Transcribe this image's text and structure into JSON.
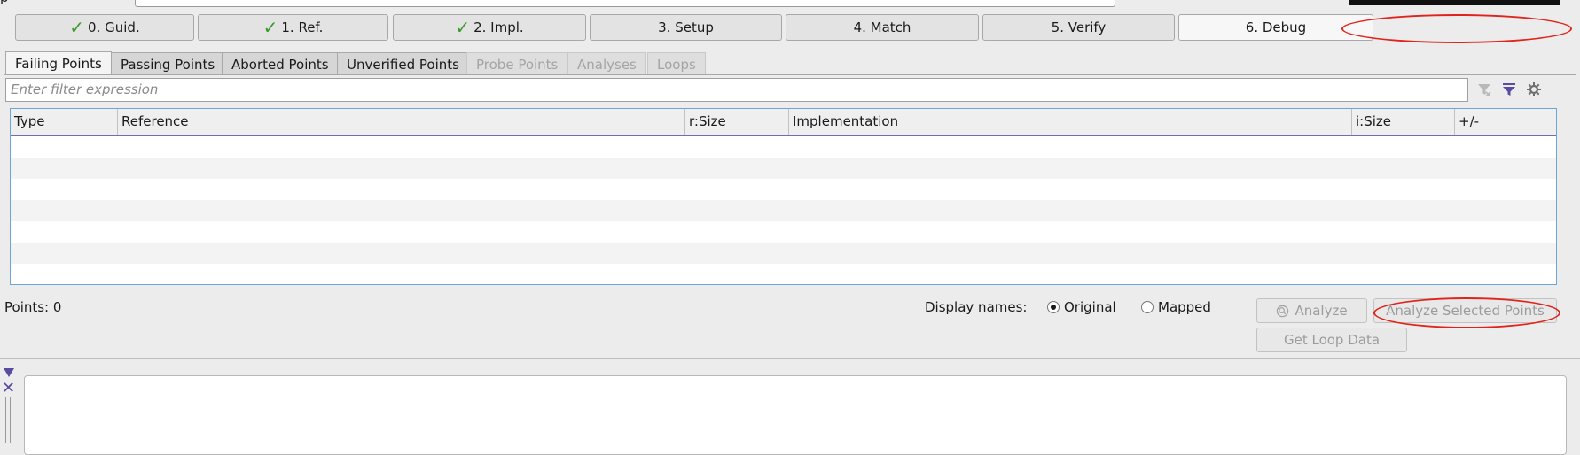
{
  "top_label": "p",
  "steps": [
    {
      "label": "0. Guid.",
      "done": true
    },
    {
      "label": "1. Ref.",
      "done": true
    },
    {
      "label": "2. Impl.",
      "done": true
    },
    {
      "label": "3. Setup",
      "done": false
    },
    {
      "label": "4. Match",
      "done": false
    },
    {
      "label": "5. Verify",
      "done": false
    },
    {
      "label": "6. Debug",
      "done": false,
      "active": true
    }
  ],
  "tabs": [
    {
      "label": "Failing Points",
      "state": "active"
    },
    {
      "label": "Passing Points",
      "state": "normal"
    },
    {
      "label": "Aborted Points",
      "state": "normal"
    },
    {
      "label": "Unverified Points",
      "state": "normal"
    },
    {
      "label": "Probe Points",
      "state": "disabled"
    },
    {
      "label": "Analyses",
      "state": "disabled"
    },
    {
      "label": "Loops",
      "state": "disabled"
    }
  ],
  "filter": {
    "placeholder": "Enter filter expression"
  },
  "table": {
    "columns": [
      "Type",
      "Reference",
      "r:Size",
      "Implementation",
      "i:Size",
      "+/-"
    ],
    "rows": []
  },
  "status": {
    "points": "Points: 0"
  },
  "display_names": {
    "label": "Display names:",
    "options": [
      "Original",
      "Mapped"
    ],
    "selected": "Original"
  },
  "buttons": {
    "analyze": "Analyze",
    "analyze_selected": "Analyze Selected Points",
    "get_loop_data": "Get Loop Data"
  },
  "colors": {
    "check": "#3a9a2e",
    "accent": "#5a4aa0",
    "annotation": "#e0241c",
    "table_border": "#6aa6d8"
  }
}
